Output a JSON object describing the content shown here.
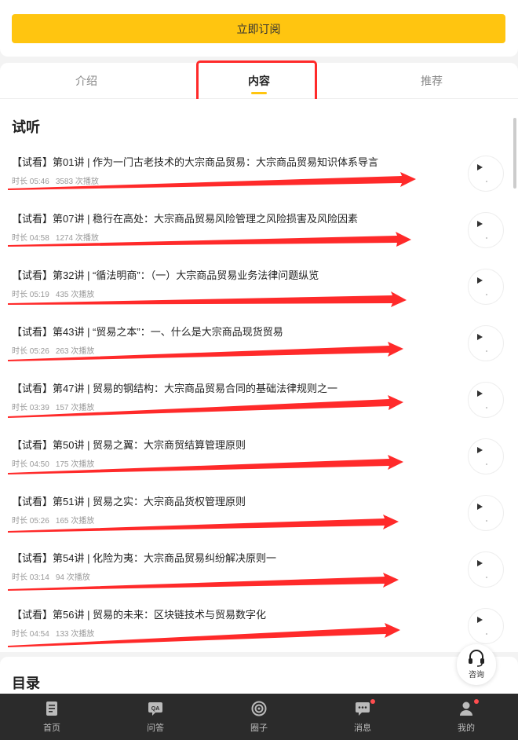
{
  "subscribe": {
    "label": "立即订阅"
  },
  "tabs": [
    {
      "label": "介绍"
    },
    {
      "label": "内容"
    },
    {
      "label": "推荐"
    }
  ],
  "trial_section": {
    "title": "试听"
  },
  "lessons": [
    {
      "title": "【试看】第01讲 | 作为一门古老技术的大宗商品贸易：大宗商品贸易知识体系导言",
      "duration": "时长 05:46",
      "plays": "3583 次播放"
    },
    {
      "title": "【试看】第07讲 | 稳行在高处：大宗商品贸易风险管理之风险损害及风险因素",
      "duration": "时长 04:58",
      "plays": "1274 次播放"
    },
    {
      "title": "【试看】第32讲 | “循法明商”：（一）大宗商品贸易业务法律问题纵览",
      "duration": "时长 05:19",
      "plays": "435 次播放"
    },
    {
      "title": "【试看】第43讲 | “贸易之本”：一、什么是大宗商品现货贸易",
      "duration": "时长 05:26",
      "plays": "263 次播放"
    },
    {
      "title": "【试看】第47讲 | 贸易的钢结构：大宗商品贸易合同的基础法律规则之一",
      "duration": "时长 03:39",
      "plays": "157 次播放"
    },
    {
      "title": "【试看】第50讲 | 贸易之翼：大宗商贸结算管理原则",
      "duration": "时长 04:50",
      "plays": "175 次播放"
    },
    {
      "title": "【试看】第51讲 | 贸易之实：大宗商品货权管理原则",
      "duration": "时长 05:26",
      "plays": "165 次播放"
    },
    {
      "title": "【试看】第54讲 | 化险为夷：大宗商品贸易纠纷解决原则一",
      "duration": "时长 03:14",
      "plays": "94 次播放"
    },
    {
      "title": "【试看】第56讲 | 贸易的未来：区块链技术与贸易数字化",
      "duration": "时长 04:54",
      "plays": "133 次播放"
    }
  ],
  "catalog_section": {
    "title": "目录"
  },
  "consult": {
    "label": "咨询"
  },
  "bottom_nav": [
    {
      "label": "首页",
      "icon": "home-doc-icon"
    },
    {
      "label": "问答",
      "icon": "qa-icon"
    },
    {
      "label": "圈子",
      "icon": "circle-icon"
    },
    {
      "label": "消息",
      "icon": "message-icon"
    },
    {
      "label": "我的",
      "icon": "user-icon"
    }
  ],
  "colors": {
    "accent": "#ffc510",
    "annotation": "#ff2a2a",
    "nav_bg": "#2b2b2b"
  }
}
